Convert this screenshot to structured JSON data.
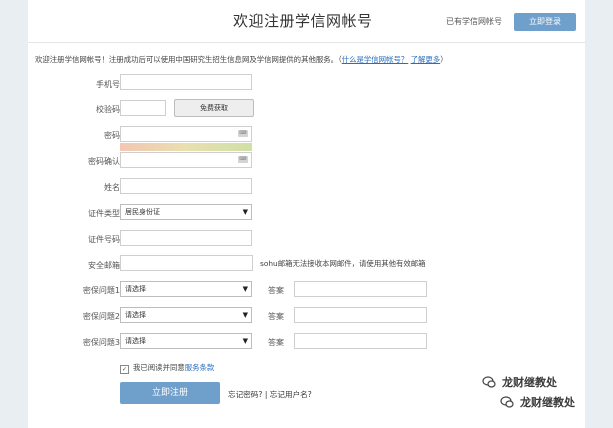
{
  "header": {
    "title": "欢迎注册学信网帐号",
    "has_account": "已有学信网帐号",
    "login_button": "立即登录"
  },
  "intro": {
    "text": "欢迎注册学信网帐号！注册成功后可以使用中国研究生招生信息网及学信网提供的其他服务。（",
    "link_what": "什么是学信网帐号？",
    "link_more": "了解更多",
    "close": "）"
  },
  "form": {
    "phone_label": "手机号",
    "code_label": "校验码",
    "free_get_button": "免费获取",
    "password_label": "密码",
    "confirm_label": "密码确认",
    "name_label": "姓名",
    "id_type_label": "证件类型",
    "id_type_value": "居民身份证",
    "id_number_label": "证件号码",
    "email_label": "安全邮箱",
    "email_note": "sohu邮箱无法接收本网邮件，请使用其他有效邮箱",
    "q1_label": "密保问题1",
    "q2_label": "密保问题2",
    "q3_label": "密保问题3",
    "select_placeholder": "请选择",
    "answer_label": "答案",
    "star": "*",
    "agree_text": "我已阅读并同意",
    "agree_link": "服务条款",
    "submit_button": "立即注册",
    "forgot_text": "忘记密码? | 忘记用户名?"
  },
  "watermark": {
    "line1": "龙财继教处",
    "line2": "龙财继教处"
  }
}
